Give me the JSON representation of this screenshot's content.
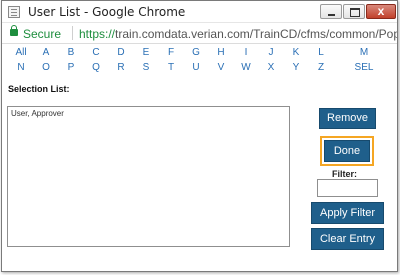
{
  "window": {
    "title": "User List - Google Chrome",
    "close_glyph": "x"
  },
  "address": {
    "secure_label": "Secure",
    "url_scheme": "https://",
    "url_rest": "train.comdata.verian.com/TrainCD/cfms/common/PopUpWin"
  },
  "alphabet": {
    "row1": [
      "All",
      "A",
      "B",
      "C",
      "D",
      "E",
      "F",
      "G",
      "H",
      "I",
      "J",
      "K",
      "L",
      "M"
    ],
    "row2": [
      "N",
      "O",
      "P",
      "Q",
      "R",
      "S",
      "T",
      "U",
      "V",
      "W",
      "X",
      "Y",
      "Z",
      "SEL"
    ]
  },
  "selection": {
    "label": "Selection List:",
    "items": [
      "User, Approver"
    ]
  },
  "actions": {
    "remove_label": "Remove",
    "done_label": "Done",
    "filter_label": "Filter:",
    "filter_value": "",
    "apply_label": "Apply Filter",
    "clear_label": "Clear Entry"
  },
  "colors": {
    "button_bg": "#1f5f8b",
    "highlight": "#f5a623",
    "secure_green": "#1e8e3e",
    "link_blue": "#2a6fb5"
  }
}
